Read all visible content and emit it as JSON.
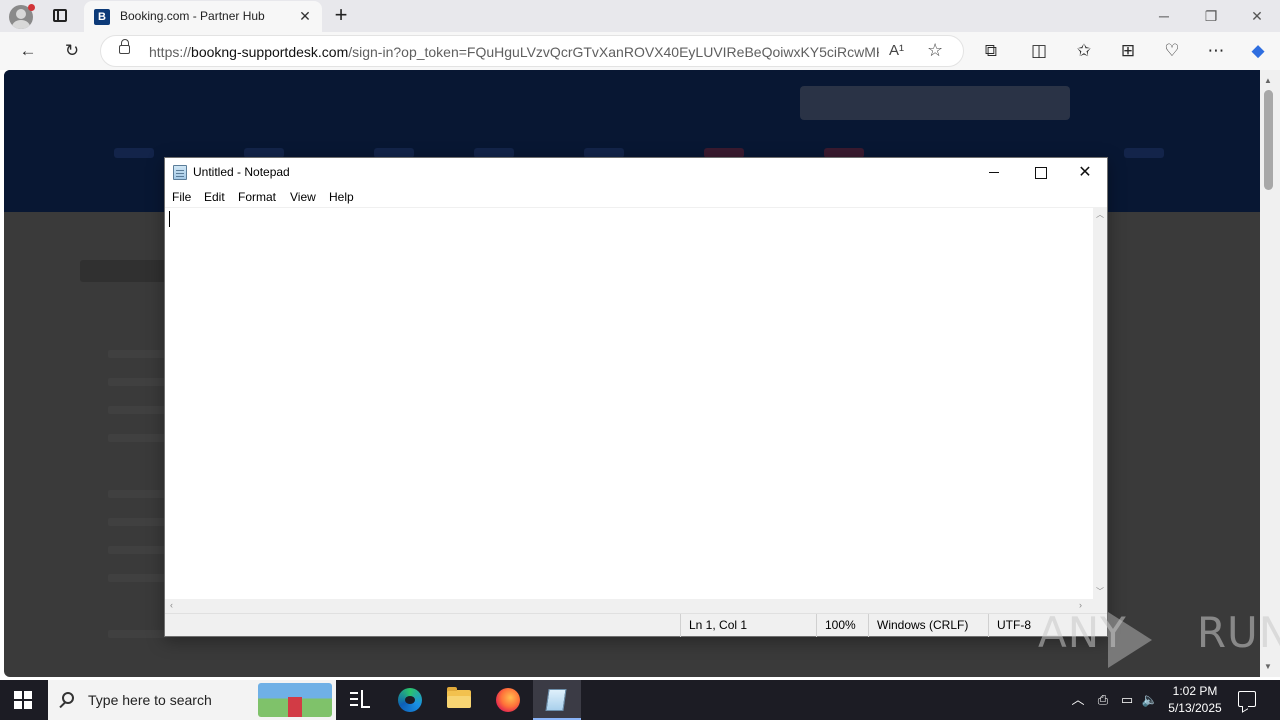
{
  "browser": {
    "tab": {
      "favicon_letter": "B",
      "title": "Booking.com - Partner Hub"
    },
    "url_host": "bookng-supportdesk.com",
    "url_prefix": "https://",
    "url_rest": "/sign-in?op_token=FQuHguLVzvQcrGTvXanROVX40EyLUVIReBeQoiwxKY5ciRcwMK...",
    "read_aloud_glyph": "A¹",
    "favicon_color": "#0c3a78"
  },
  "notepad": {
    "title": "Untitled - Notepad",
    "menu": [
      "File",
      "Edit",
      "Format",
      "View",
      "Help"
    ],
    "content": "",
    "status": {
      "position": "Ln 1, Col 1",
      "zoom": "100%",
      "line_endings": "Windows (CRLF)",
      "encoding": "UTF-8"
    }
  },
  "watermark": {
    "left": "ANY",
    "right": "RUN"
  },
  "taskbar": {
    "search_placeholder": "Type here to search",
    "apps": [
      "task-view",
      "edge",
      "file-explorer",
      "firefox",
      "notepad"
    ],
    "active_app": "notepad",
    "time": "1:02 PM",
    "date": "5/13/2025"
  }
}
